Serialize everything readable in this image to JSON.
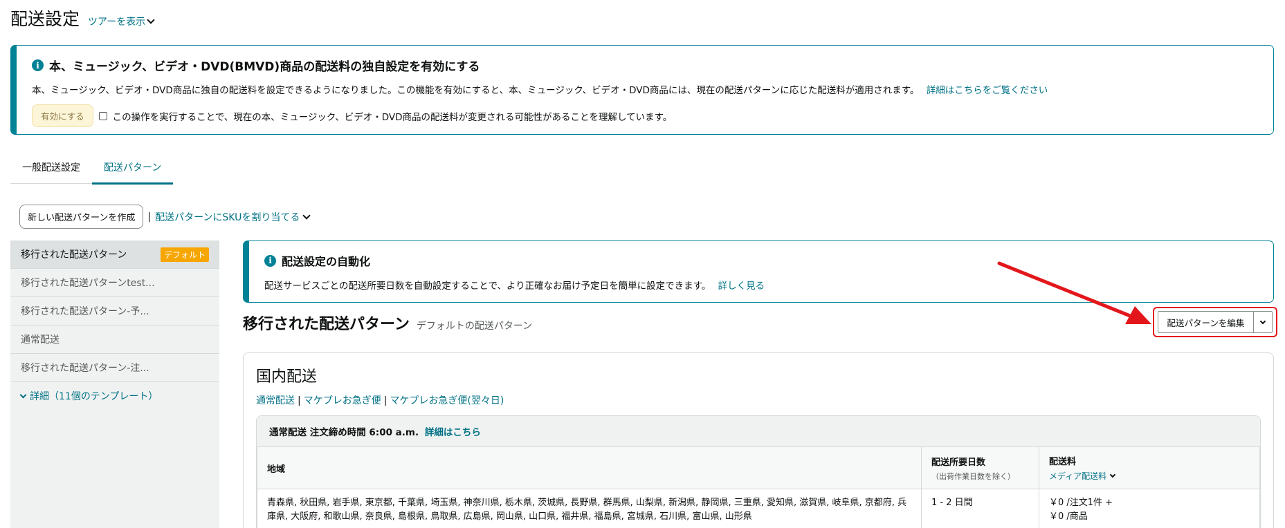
{
  "header": {
    "title": "配送設定",
    "tour_link": "ツアーを表示"
  },
  "alert_bmvd": {
    "title": "本、ミュージック、ビデオ・DVD(BMVD)商品の配送料の独自設定を有効にする",
    "body": "本、ミュージック、ビデオ・DVD商品に独自の配送料を設定できるようになりました。この機能を有効にすると、本、ミュージック、ビデオ・DVD商品には、現在の配送パターンに応じた配送料が適用されます。",
    "details_link": "詳細はこちらをご覧ください",
    "enable_button": "有効にする",
    "checkbox_label": "この操作を実行することで、現在の本、ミュージック、ビデオ・DVD商品の配送料が変更される可能性があることを理解しています。"
  },
  "tabs": [
    {
      "label": "一般配送設定",
      "active": false
    },
    {
      "label": "配送パターン",
      "active": true
    }
  ],
  "actions": {
    "new_pattern_button": "新しい配送パターンを作成",
    "separator": "|",
    "assign_sku_link": "配送パターンにSKUを割り当てる"
  },
  "sidebar": {
    "items": [
      {
        "label": "移行された配送パターン",
        "badge": "デフォルト",
        "active": true
      },
      {
        "label": "移行された配送パターンtest..."
      },
      {
        "label": "移行された配送パターン-予..."
      },
      {
        "label": "通常配送"
      },
      {
        "label": "移行された配送パターン-注..."
      }
    ],
    "more_link": "詳細（11個のテンプレート）"
  },
  "alert_automation": {
    "title": "配送設定の自動化",
    "body": "配送サービスごとの配送所要日数を自動設定することで、より正確なお届け予定日を簡単に設定できます。",
    "learn_more_link": "詳しく見る"
  },
  "pattern": {
    "title": "移行された配送パターン",
    "subtitle": "デフォルトの配送パターン",
    "edit_button": "配送パターンを編集"
  },
  "domestic": {
    "title": "国内配送",
    "methods": [
      "通常配送",
      "マケプレお急ぎ便",
      "マケプレお急ぎ便(翌々日)"
    ],
    "table_caption_prefix": "通常配送 注文締め時間 6:00 a.m.",
    "table_caption_link": "詳細はこちら",
    "columns": {
      "region": "地域",
      "transit": "配送所要日数",
      "transit_sub": "（出荷作業日数を除く）",
      "fee": "配送料",
      "fee_sub": "メディア配送料"
    },
    "rows": [
      {
        "region": "青森県, 秋田県, 岩手県, 東京都, 千葉県, 埼玉県, 神奈川県, 栃木県, 茨城県, 長野県, 群馬県, 山梨県, 新潟県, 静岡県, 三重県, 愛知県, 滋賀県, 岐阜県, 京都府, 兵庫県, 大阪府, 和歌山県, 奈良県, 島根県, 鳥取県, 広島県, 岡山県, 山口県, 福井県, 福島県, 宮城県, 石川県, 富山県, 山形県",
        "transit": "1 - 2 日間",
        "fee_line1": "￥0 /注文1件 +",
        "fee_line2": "￥0 /商品"
      }
    ]
  },
  "colors": {
    "link": "#007185",
    "accent_border": "#008296",
    "badge": "#f7a600",
    "highlight": "#e3171b"
  }
}
